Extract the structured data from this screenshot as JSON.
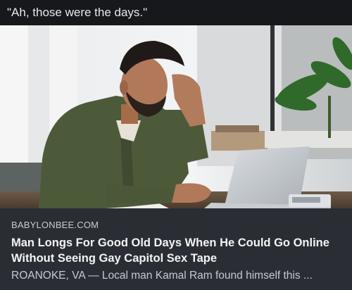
{
  "post": {
    "caption": "\"Ah, those were the days.\""
  },
  "link_card": {
    "source": "BABYLONBEE.COM",
    "headline": "Man Longs For Good Old Days When He Could Go Online Without Seeing Gay Capitol Sex Tape",
    "excerpt": "ROANOKE, VA — Local man Kamal Ram found himself this ..."
  },
  "colors": {
    "background": "#17181c",
    "card": "#2a2d33",
    "headline": "#f3f4f6",
    "muted": "#c7cad0"
  }
}
